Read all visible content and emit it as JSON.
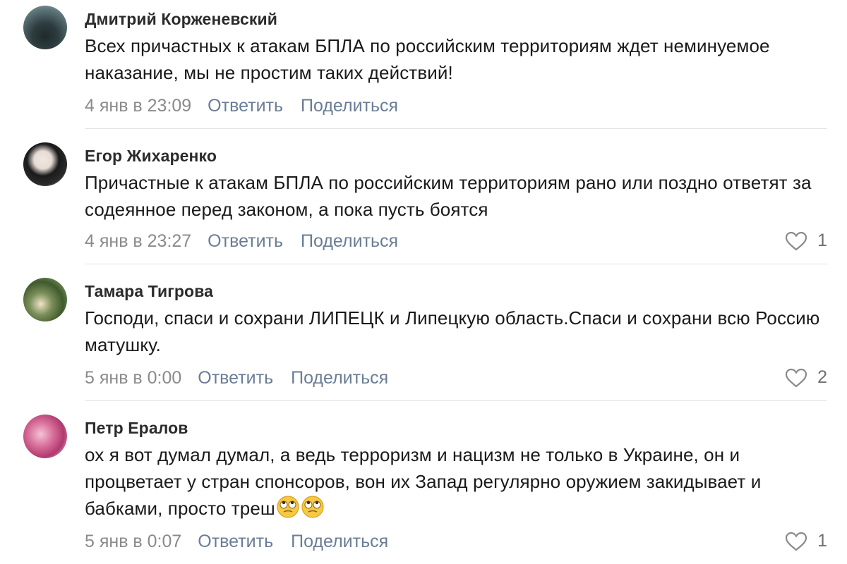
{
  "comments": [
    {
      "author": "Дмитрий Корженевский",
      "text": "Всех причастных к атакам БПЛА по российским территориям ждет неминуемое наказание, мы не простим таких действий!",
      "date": "4 янв в 23:09",
      "reply_label": "Ответить",
      "share_label": "Поделиться",
      "likes": ""
    },
    {
      "author": "Егор Жихаренко",
      "text": "Причастные к атакам БПЛА по российским территориям рано или поздно ответят за содеянное перед законом, а пока пусть боятся",
      "date": "4 янв в 23:27",
      "reply_label": "Ответить",
      "share_label": "Поделиться",
      "likes": "1"
    },
    {
      "author": "Тамара Тигрова",
      "text": "Господи, спаси и сохрани ЛИПЕЦК и Липецкую область.Спаси и сохрани всю Россию матушку.",
      "date": "5 янв в 0:00",
      "reply_label": "Ответить",
      "share_label": "Поделиться",
      "likes": "2"
    },
    {
      "author": "Петр Ералов",
      "text": "ох я вот думал думал, а ведь терроризм и нацизм не только в Украине, он и процветает у стран спонсоров, вон их Запад регулярно оружием закидывает и бабками, просто треш",
      "emoji": [
        "rolling-eyes-emoji",
        "rolling-eyes-emoji"
      ],
      "date": "5 янв в 0:07",
      "reply_label": "Ответить",
      "share_label": "Поделиться",
      "likes": "1"
    }
  ],
  "icons": {
    "like": "heart-outline-icon"
  },
  "colors": {
    "author": "#2b2b2b",
    "text": "#1a1a1a",
    "date": "#8a8a8a",
    "action_link": "#6a7d95",
    "like_count": "#707070",
    "separator": "#e2e2e2"
  }
}
